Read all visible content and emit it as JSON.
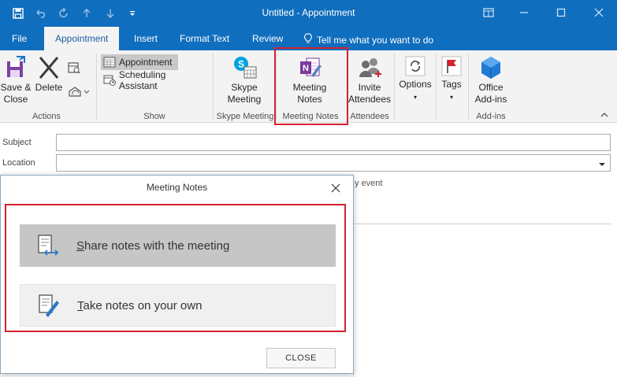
{
  "window": {
    "title": "Untitled - Appointment",
    "qat_icons": [
      "save-icon",
      "undo-icon",
      "redo-icon",
      "up-icon",
      "down-icon",
      "customize-icon"
    ],
    "controls": [
      "restore-ribbon-icon",
      "minimize-icon",
      "maximize-icon",
      "close-icon"
    ]
  },
  "tabs": {
    "file": "File",
    "appointment": "Appointment",
    "insert": "Insert",
    "format_text": "Format Text",
    "review": "Review",
    "tell_me": "Tell me what you want to do"
  },
  "ribbon": {
    "actions": {
      "save_close": "Save &",
      "save_close_2": "Close",
      "delete": "Delete",
      "label": "Actions"
    },
    "show": {
      "appointment": "Appointment",
      "scheduling": "Scheduling Assistant",
      "label": "Show"
    },
    "skype": {
      "btn_1": "Skype",
      "btn_2": "Meeting",
      "label": "Skype Meeting"
    },
    "notes": {
      "btn_1": "Meeting",
      "btn_2": "Notes",
      "label": "Meeting Notes"
    },
    "attendees": {
      "btn_1": "Invite",
      "btn_2": "Attendees",
      "label": "Attendees"
    },
    "options": {
      "label": "Options"
    },
    "tags": {
      "label": "Tags"
    },
    "addins": {
      "btn_1": "Office",
      "btn_2": "Add-ins",
      "label": "Add-ins"
    }
  },
  "form": {
    "subject_label": "Subject",
    "location_label": "Location",
    "subject_value": "",
    "location_value": "",
    "hint_fragment": "y event"
  },
  "dialog": {
    "title": "Meeting Notes",
    "share_prefix": "S",
    "share_rest": "hare notes with the meeting",
    "take_prefix": "T",
    "take_rest": "ake notes on your own",
    "close": "CLOSE"
  },
  "colors": {
    "titlebar": "#106ebe",
    "accent": "#1e5fa6",
    "highlight_border": "#d6202e",
    "onenote": "#7a3b9e",
    "skype": "#00a3e0"
  }
}
